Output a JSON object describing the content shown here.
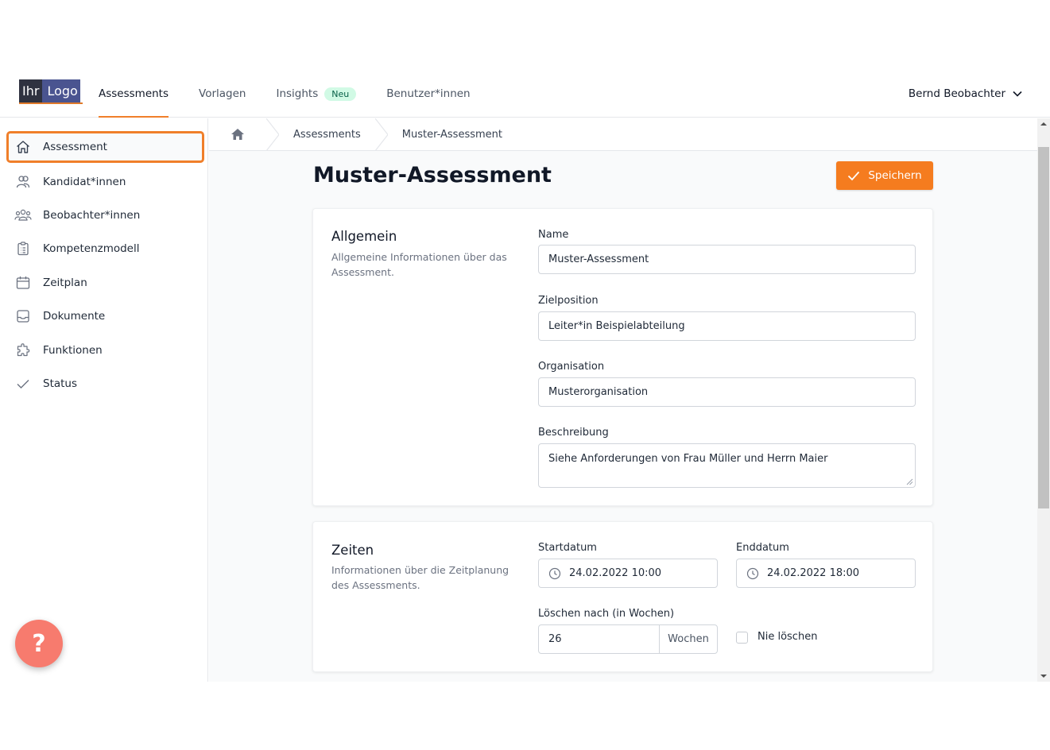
{
  "logo": {
    "part1": "Ihr",
    "part2": "Logo"
  },
  "nav": {
    "items": [
      {
        "label": "Assessments",
        "active": true
      },
      {
        "label": "Vorlagen"
      },
      {
        "label": "Insights",
        "badge": "Neu"
      },
      {
        "label": "Benutzer*innen"
      }
    ],
    "user": "Bernd Beobachter"
  },
  "sidebar": {
    "items": [
      {
        "label": "Assessment",
        "icon": "home-icon",
        "active": true
      },
      {
        "label": "Kandidat*innen",
        "icon": "users-icon"
      },
      {
        "label": "Beobachter*innen",
        "icon": "user-group-icon"
      },
      {
        "label": "Kompetenzmodell",
        "icon": "clipboard-icon"
      },
      {
        "label": "Zeitplan",
        "icon": "calendar-icon"
      },
      {
        "label": "Dokumente",
        "icon": "inbox-icon"
      },
      {
        "label": "Funktionen",
        "icon": "puzzle-icon"
      },
      {
        "label": "Status",
        "icon": "check-icon"
      }
    ],
    "help": "?"
  },
  "breadcrumb": {
    "items": [
      "Assessments",
      "Muster-Assessment"
    ]
  },
  "page": {
    "title": "Muster-Assessment",
    "save_label": "Speichern"
  },
  "allgemein": {
    "title": "Allgemein",
    "description": "Allgemeine Informationen über das Assessment.",
    "name_label": "Name",
    "name_value": "Muster-Assessment",
    "position_label": "Zielposition",
    "position_value": "Leiter*in Beispielabteilung",
    "org_label": "Organisation",
    "org_value": "Musterorganisation",
    "desc_label": "Beschreibung",
    "desc_value": "Siehe Anforderungen von Frau Müller und Herrn Maier"
  },
  "zeiten": {
    "title": "Zeiten",
    "description": "Informationen über die Zeitplanung des Assessments.",
    "start_label": "Startdatum",
    "start_value": "24.02.2022 10:00",
    "end_label": "Enddatum",
    "end_value": "24.02.2022 18:00",
    "delete_label": "Löschen nach (in Wochen)",
    "delete_value": "26",
    "delete_unit": "Wochen",
    "never_label": "Nie löschen"
  },
  "colors": {
    "accent": "#f57c1f",
    "help": "#f77b6e"
  }
}
